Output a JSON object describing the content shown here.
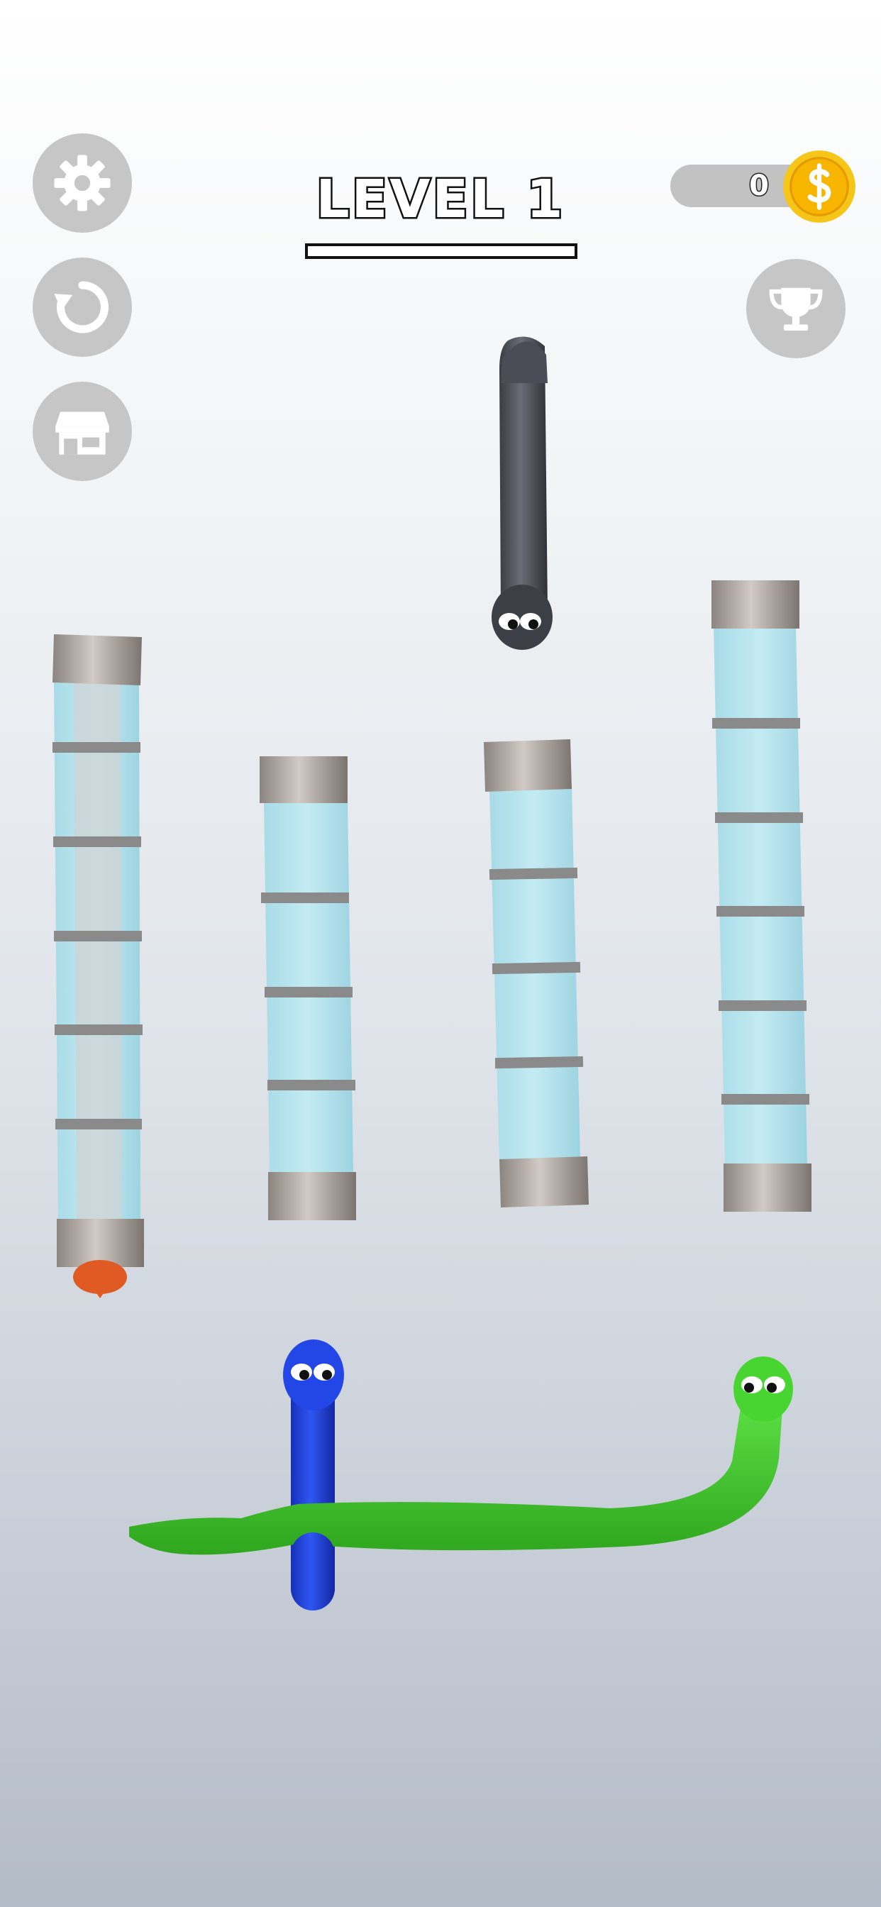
{
  "hud": {
    "level_title": "LEVEL 1",
    "level_progress": 0,
    "coins": "0",
    "buttons": {
      "settings": "gear-icon",
      "restart": "restart-icon",
      "shop": "shop-icon",
      "leaderboard": "trophy-icon"
    },
    "button_color": "#c6c6c6",
    "coin_color": "#f5b800"
  },
  "board": {
    "tube_count": 4,
    "tube_segments": [
      6,
      4,
      4,
      6
    ],
    "snakes": [
      {
        "color": "#4a4d55",
        "name": "black"
      },
      {
        "color": "#e05a24",
        "name": "orange"
      },
      {
        "color": "#1e3fd8",
        "name": "blue"
      },
      {
        "color": "#3fcf2a",
        "name": "green"
      }
    ]
  }
}
